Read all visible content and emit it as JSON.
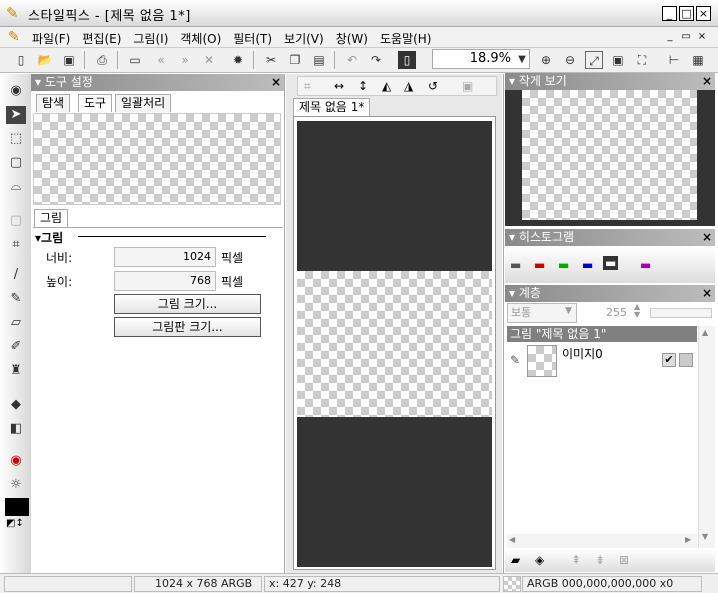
{
  "window": {
    "title": "스타일픽스 - [제목 없음 1*]",
    "minimize": "_",
    "maximize": "□",
    "close": "×"
  },
  "menu": [
    "파일(F)",
    "편집(E)",
    "그림(I)",
    "객체(O)",
    "필터(T)",
    "보기(V)",
    "창(W)",
    "도움말(H)"
  ],
  "mdi": {
    "minimize": "_",
    "restore": "▭",
    "close": "×"
  },
  "toolbar": {
    "zoom": "18.9%"
  },
  "tool_settings": {
    "title": "도구 설정",
    "tabs": [
      "탐색",
      "도구",
      "일괄처리"
    ],
    "sub_tab": "그림",
    "section": "그림",
    "width_label": "너비:",
    "width_value": "1024",
    "width_unit": "픽셀",
    "height_label": "높이:",
    "height_value": "768",
    "height_unit": "픽셀",
    "btn_image_size": "그림 크기...",
    "btn_canvas_size": "그림판 크기..."
  },
  "document": {
    "tab": "제목 없음 1*"
  },
  "thumbnail": {
    "title": "작게 보기"
  },
  "histogram": {
    "title": "히스토그램"
  },
  "layers": {
    "title": "계층",
    "blend_mode": "보통",
    "opacity": "255",
    "group_label": "그림 \"제목 없음 1\"",
    "layer_name": "이미지0"
  },
  "status": {
    "dimensions": "1024 x 768 ARGB",
    "coords": "x: 427 y: 248",
    "color": "ARGB 000,000,000,000 x0"
  }
}
